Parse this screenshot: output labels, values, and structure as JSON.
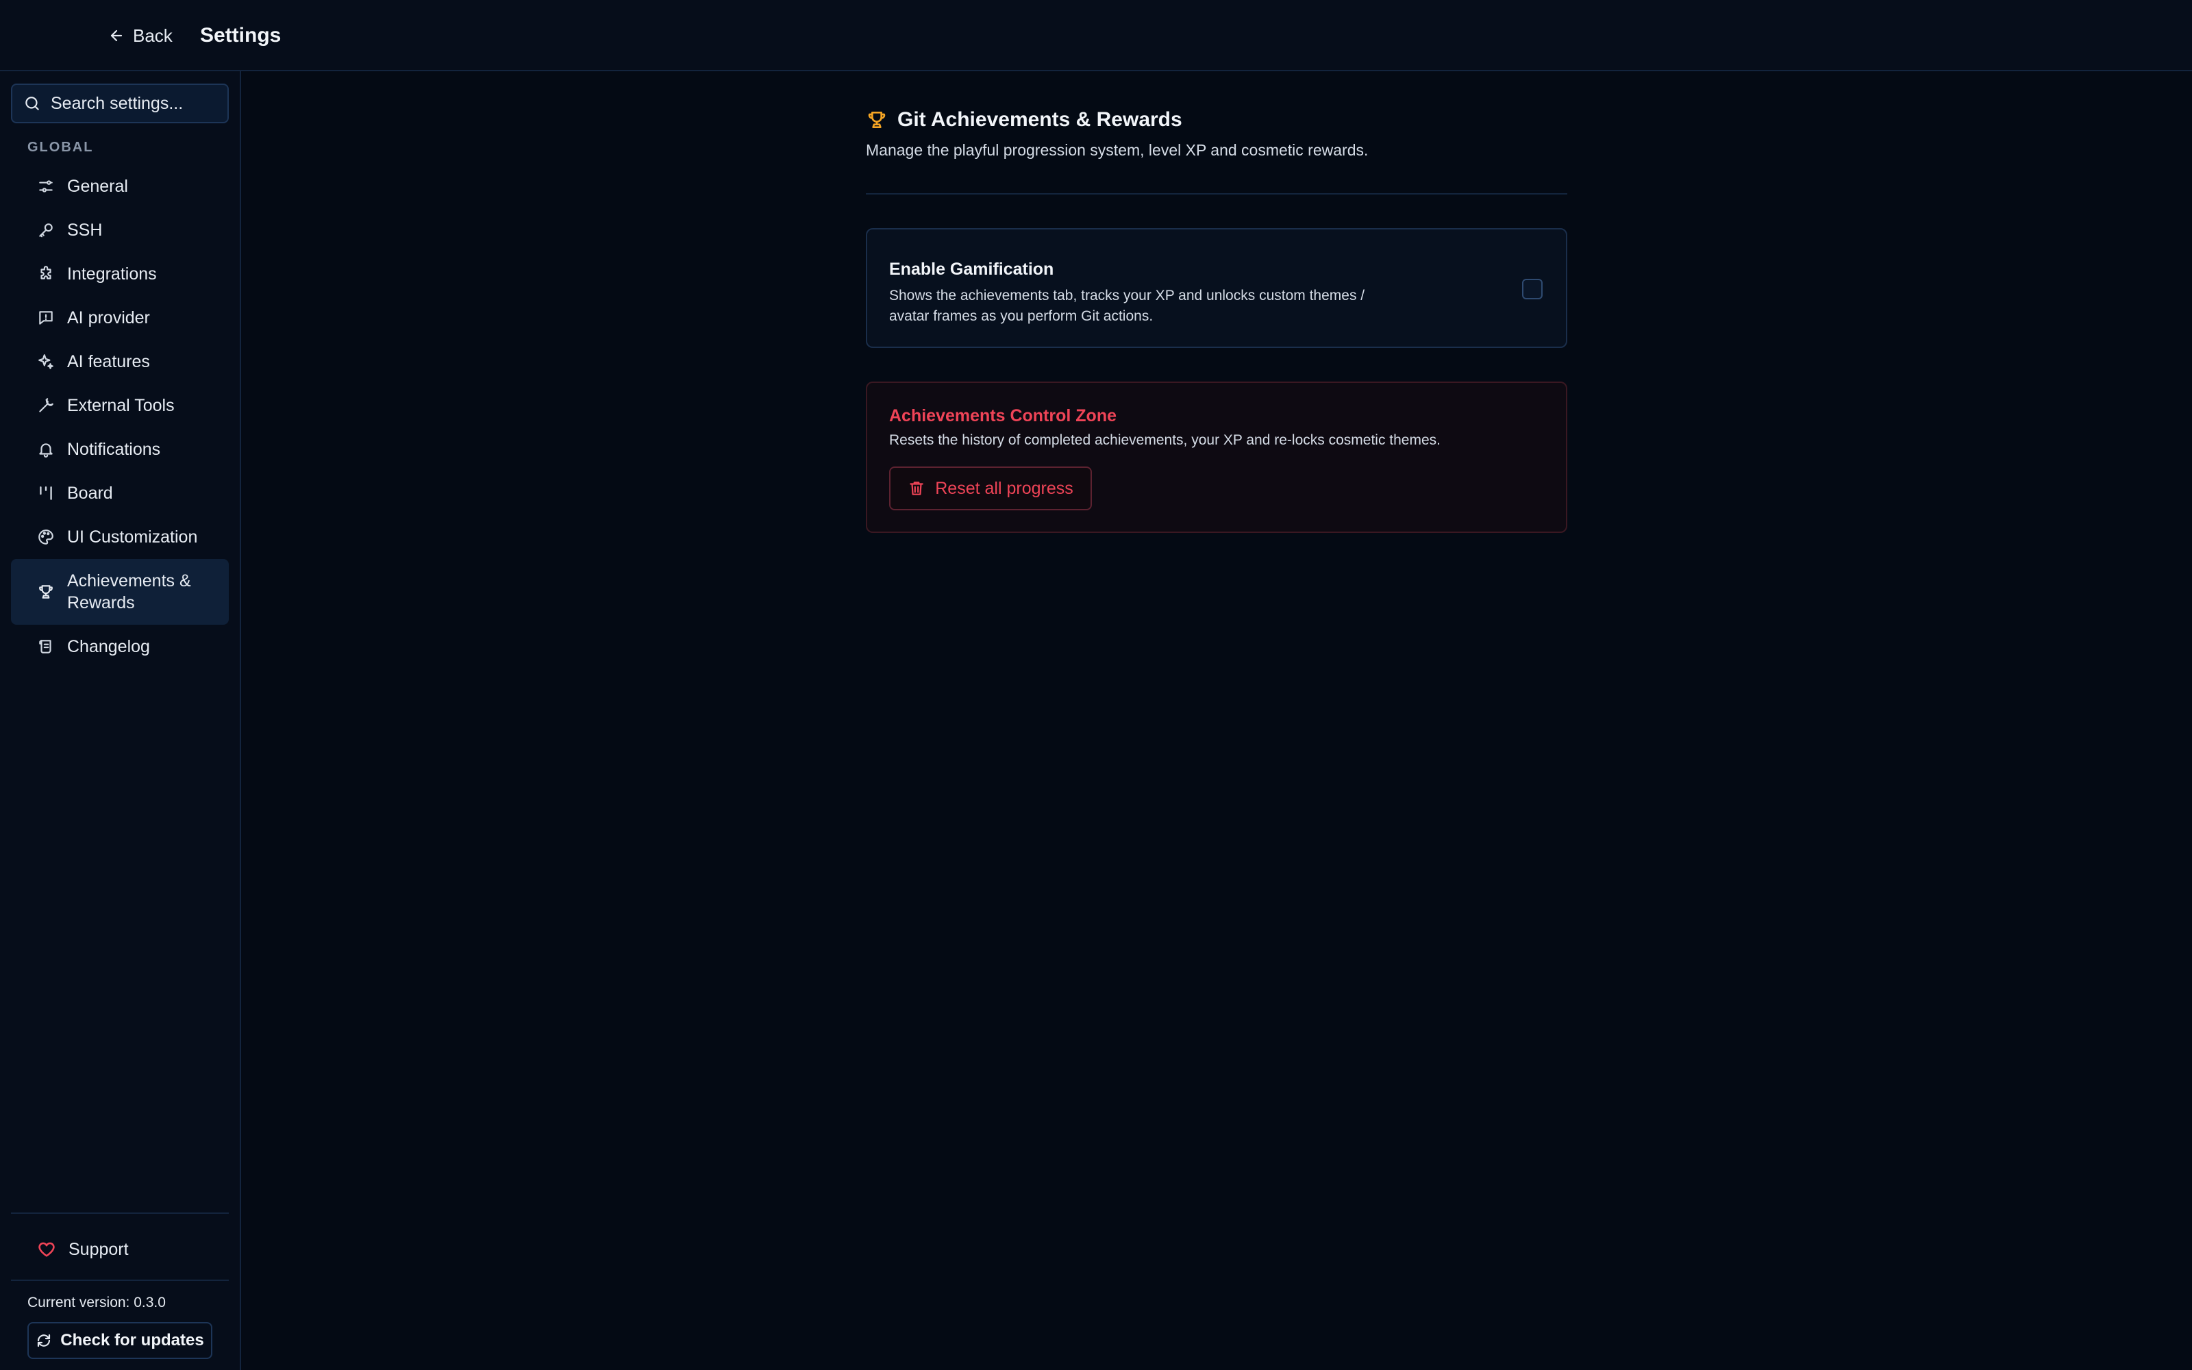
{
  "colors": {
    "accent_trophy": "#f5a524",
    "danger": "#ef4457",
    "support_heart": "#ef4457",
    "background": "#040a14",
    "sidebar_active": "#0f2038"
  },
  "topbar": {
    "back_label": "Back",
    "back_icon": "arrow-left-icon",
    "title": "Settings"
  },
  "sidebar": {
    "search_placeholder": "Search settings...",
    "search_icon": "search-icon",
    "section_label": "GLOBAL",
    "items": [
      {
        "label": "General",
        "icon": "sliders-icon"
      },
      {
        "label": "SSH",
        "icon": "key-icon"
      },
      {
        "label": "Integrations",
        "icon": "puzzle-icon"
      },
      {
        "label": "AI provider",
        "icon": "message-square-icon"
      },
      {
        "label": "AI features",
        "icon": "sparkles-icon"
      },
      {
        "label": "External Tools",
        "icon": "wrench-icon"
      },
      {
        "label": "Notifications",
        "icon": "bell-icon"
      },
      {
        "label": "Board",
        "icon": "kanban-icon"
      },
      {
        "label": "UI Customization",
        "icon": "palette-icon"
      },
      {
        "label": "Achievements & Rewards",
        "icon": "trophy-icon",
        "active": true
      },
      {
        "label": "Changelog",
        "icon": "scroll-icon"
      }
    ],
    "support_label": "Support",
    "version_text": "Current version: 0.3.0",
    "update_label": "Check for updates"
  },
  "main": {
    "title": "Git Achievements & Rewards",
    "subtitle": "Manage the playful progression system, level XP and cosmetic rewards.",
    "gamification": {
      "title": "Enable Gamification",
      "description": "Shows the achievements tab, tracks your XP and unlocks custom themes / avatar frames as you perform Git actions.",
      "enabled": false
    },
    "control_zone": {
      "title": "Achievements Control Zone",
      "description": "Resets the history of completed achievements, your XP and re-locks cosmetic themes.",
      "reset_label": "Reset all progress"
    }
  }
}
